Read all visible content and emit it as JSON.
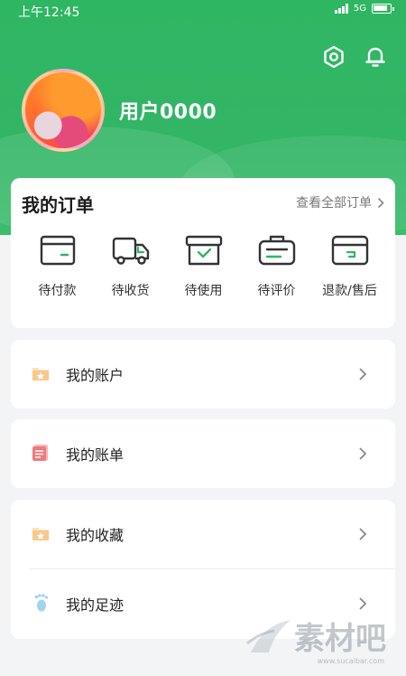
{
  "status_bar": {
    "time": "上午12:45",
    "network": "5G"
  },
  "header": {
    "username": "用户0000",
    "icons": [
      "settings-icon",
      "bell-icon"
    ],
    "accent": "#2fb663"
  },
  "orders": {
    "title": "我的订单",
    "view_all": "查看全部订单",
    "items": [
      {
        "label": "待付款",
        "icon": "card-icon"
      },
      {
        "label": "待收货",
        "icon": "truck-icon"
      },
      {
        "label": "待使用",
        "icon": "box-check-icon"
      },
      {
        "label": "待评价",
        "icon": "clipboard-icon"
      },
      {
        "label": "退款/售后",
        "icon": "return-box-icon"
      }
    ]
  },
  "menu": {
    "account": {
      "label": "我的账户",
      "icon": "folder-star-icon"
    },
    "bill": {
      "label": "我的账单",
      "icon": "bill-icon"
    },
    "favorites": {
      "label": "我的收藏",
      "icon": "folder-star-icon"
    },
    "footprints": {
      "label": "我的足迹",
      "icon": "footprint-icon"
    }
  },
  "watermark": {
    "text": "素材吧",
    "sub": "www.sucaibar.com"
  }
}
